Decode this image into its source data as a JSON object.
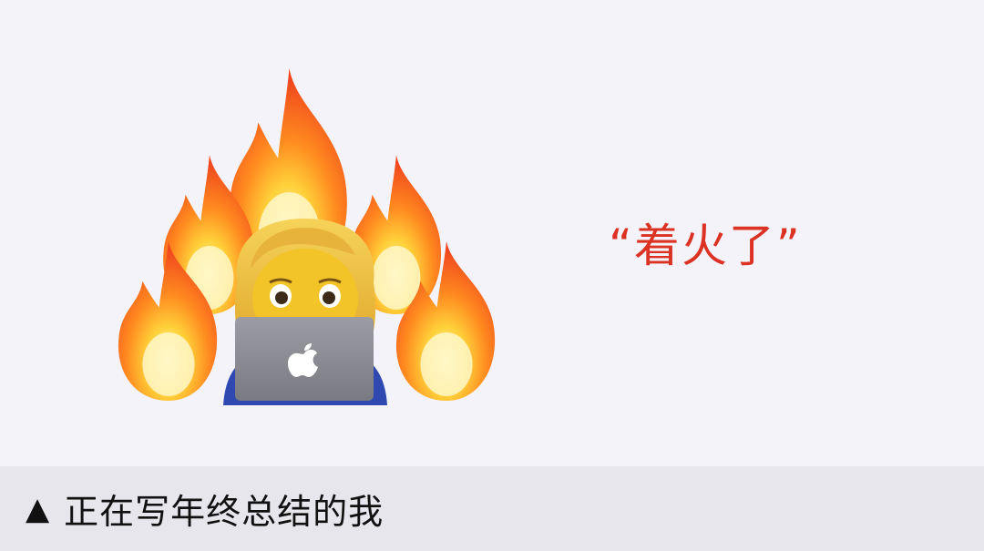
{
  "scene": {
    "quote": "“着火了”",
    "icons": [
      "fire-icon",
      "woman-technologist-icon",
      "laptop-icon",
      "apple-logo-icon"
    ],
    "colors": {
      "background": "#f4f3fa",
      "quote": "#dc3223",
      "caption_bar": "#e7e6ed",
      "caption_text": "#111111"
    }
  },
  "caption": {
    "marker": "▲",
    "text": "正在写年终总结的我"
  }
}
